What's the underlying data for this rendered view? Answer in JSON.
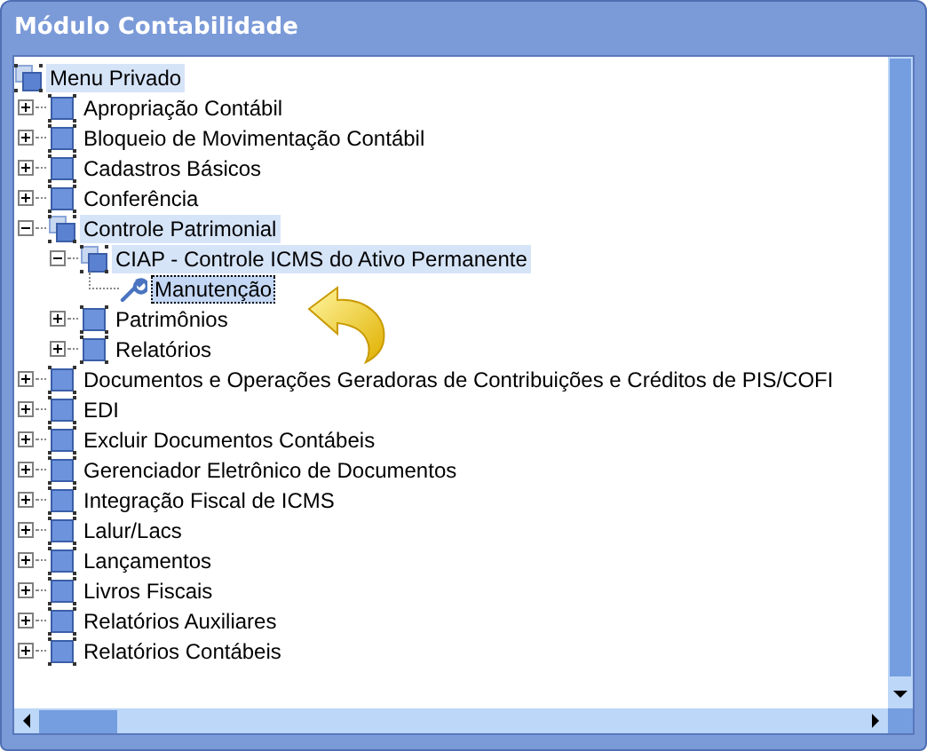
{
  "window": {
    "title": "Módulo Contabilidade"
  },
  "tree": {
    "label": "Menu Privado",
    "kind": "folder",
    "expanded": true,
    "selected": false,
    "children": [
      {
        "label": "Apropriação Contábil",
        "kind": "folder",
        "expanded": false,
        "selected": false
      },
      {
        "label": "Bloqueio de Movimentação Contábil",
        "kind": "folder",
        "expanded": false,
        "selected": false
      },
      {
        "label": "Cadastros Básicos",
        "kind": "folder",
        "expanded": false,
        "selected": false
      },
      {
        "label": "Conferência",
        "kind": "folder",
        "expanded": false,
        "selected": false
      },
      {
        "label": "Controle Patrimonial",
        "kind": "folder",
        "expanded": true,
        "selected": false,
        "children": [
          {
            "label": "CIAP - Controle ICMS do Ativo Permanente",
            "kind": "folder",
            "expanded": true,
            "selected": false,
            "children": [
              {
                "label": "Manutenção",
                "kind": "item",
                "selected": true
              }
            ]
          },
          {
            "label": "Patrimônios",
            "kind": "folder",
            "expanded": false,
            "selected": false
          },
          {
            "label": "Relatórios",
            "kind": "folder",
            "expanded": false,
            "selected": false
          }
        ]
      },
      {
        "label": "Documentos e Operações Geradoras de Contribuições e Créditos de PIS/COFI",
        "kind": "folder",
        "expanded": false,
        "selected": false
      },
      {
        "label": "EDI",
        "kind": "folder",
        "expanded": false,
        "selected": false
      },
      {
        "label": "Excluir Documentos Contábeis",
        "kind": "folder",
        "expanded": false,
        "selected": false
      },
      {
        "label": "Gerenciador Eletrônico de Documentos",
        "kind": "folder",
        "expanded": false,
        "selected": false
      },
      {
        "label": "Integração Fiscal de ICMS",
        "kind": "folder",
        "expanded": false,
        "selected": false
      },
      {
        "label": "Lalur/Lacs",
        "kind": "folder",
        "expanded": false,
        "selected": false
      },
      {
        "label": "Lançamentos",
        "kind": "folder",
        "expanded": false,
        "selected": false
      },
      {
        "label": "Livros Fiscais",
        "kind": "folder",
        "expanded": false,
        "selected": false
      },
      {
        "label": "Relatórios Auxiliares",
        "kind": "folder",
        "expanded": false,
        "selected": false
      },
      {
        "label": "Relatórios Contábeis",
        "kind": "folder",
        "expanded": false,
        "selected": false
      }
    ]
  }
}
